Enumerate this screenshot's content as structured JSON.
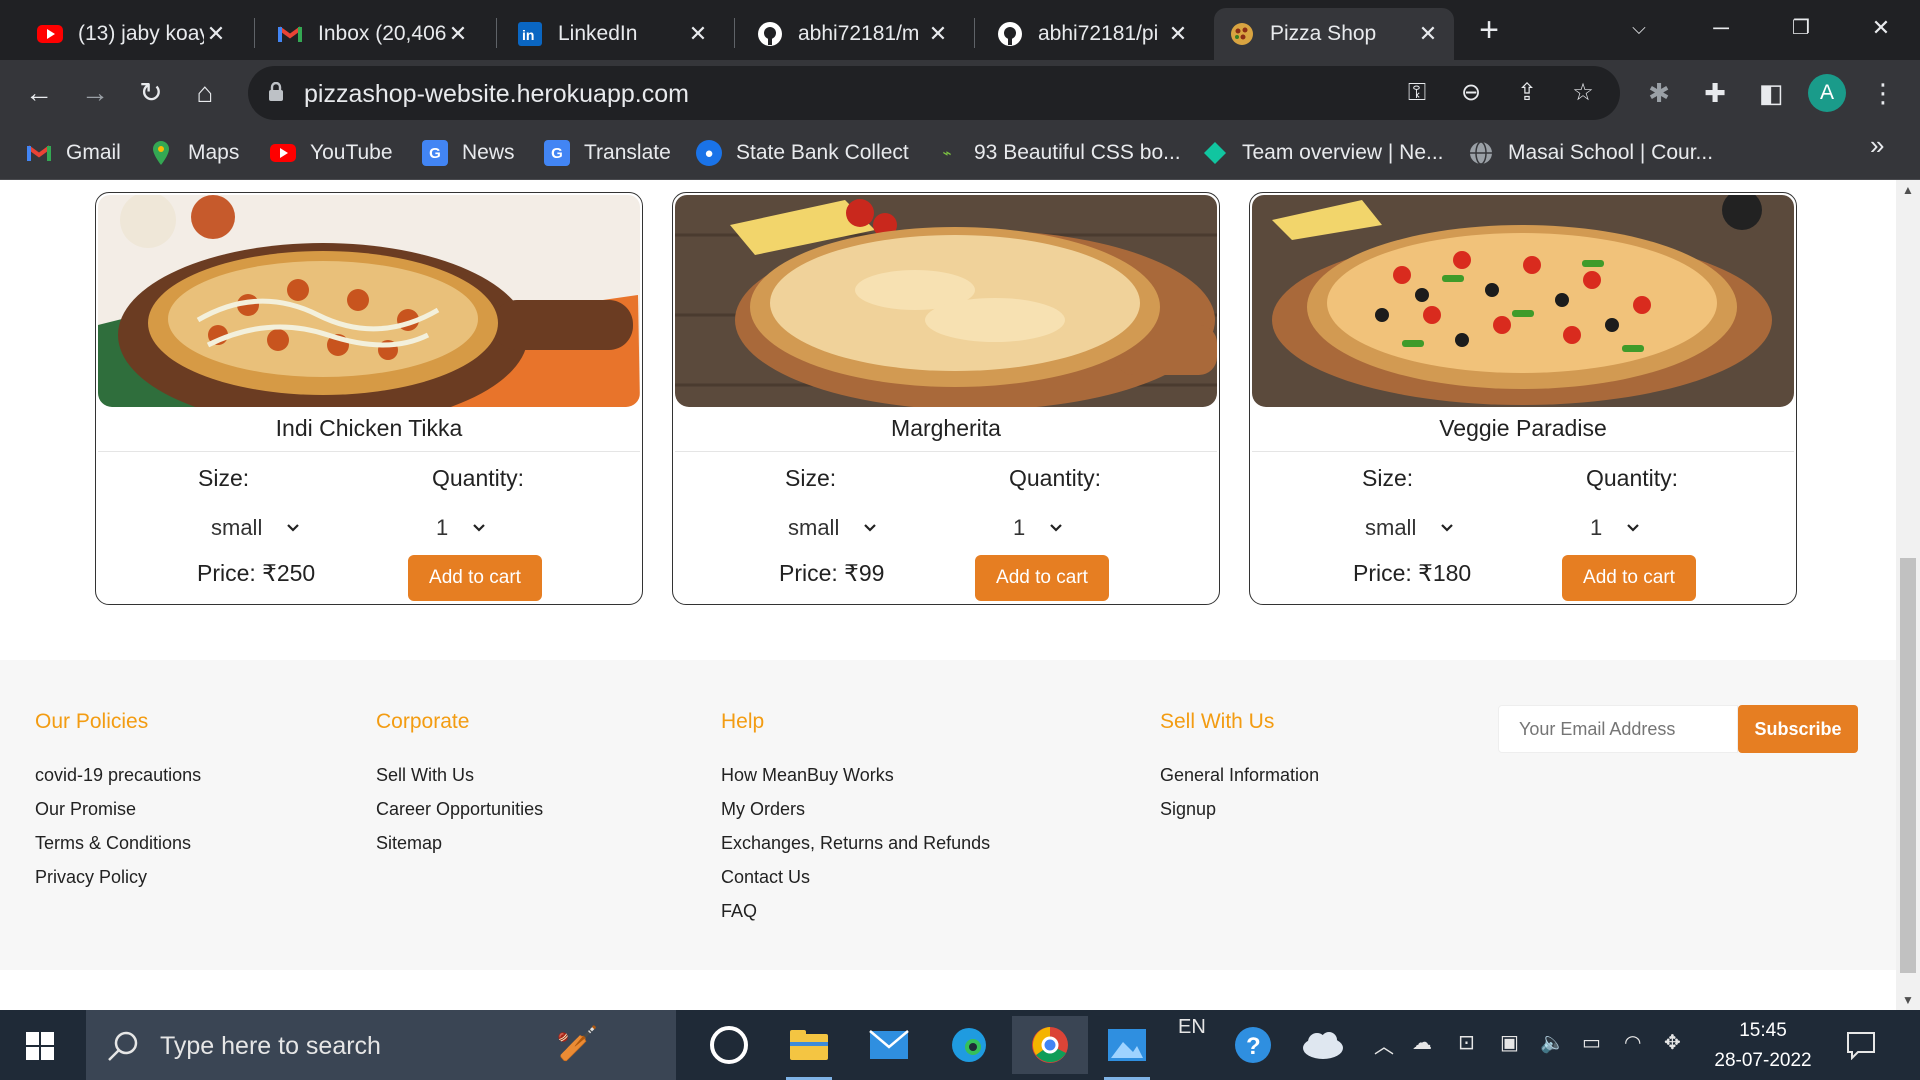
{
  "browser": {
    "tabs": [
      {
        "title": "(13) jaby koay",
        "icon": "youtube-icon"
      },
      {
        "title": "Inbox (20,406",
        "icon": "gmail-icon"
      },
      {
        "title": "LinkedIn",
        "icon": "linkedin-icon"
      },
      {
        "title": "abhi72181/m",
        "icon": "github-icon"
      },
      {
        "title": "abhi72181/pi",
        "icon": "github-icon"
      },
      {
        "title": "Pizza Shop",
        "icon": "pizza-icon",
        "active": true
      }
    ],
    "url": "pizzashop-website.herokuapp.com",
    "profile_initial": "A",
    "bookmarks": [
      {
        "label": "Gmail",
        "icon": "gmail-icon"
      },
      {
        "label": "Maps",
        "icon": "maps-icon"
      },
      {
        "label": "YouTube",
        "icon": "youtube-icon"
      },
      {
        "label": "News",
        "icon": "news-icon"
      },
      {
        "label": "Translate",
        "icon": "translate-icon"
      },
      {
        "label": "State Bank Collect",
        "icon": "sbi-icon"
      },
      {
        "label": "93 Beautiful CSS bo...",
        "icon": "css-icon"
      },
      {
        "label": "Team overview | Ne...",
        "icon": "diamond-icon"
      },
      {
        "label": "Masai School | Cour...",
        "icon": "globe-icon"
      }
    ]
  },
  "products": [
    {
      "name": "Indi Chicken Tikka",
      "size_label": "Size:",
      "size": "small",
      "qty_label": "Quantity:",
      "qty": "1",
      "price": "Price: ₹250",
      "button": "Add to cart"
    },
    {
      "name": "Margherita",
      "size_label": "Size:",
      "size": "small",
      "qty_label": "Quantity:",
      "qty": "1",
      "price": "Price: ₹99",
      "button": "Add to cart"
    },
    {
      "name": "Veggie Paradise",
      "size_label": "Size:",
      "size": "small",
      "qty_label": "Quantity:",
      "qty": "1",
      "price": "Price: ₹180",
      "button": "Add to cart"
    }
  ],
  "footer": {
    "columns": [
      {
        "heading": "Our Policies",
        "links": [
          "covid-19 precautions",
          "Our Promise",
          "Terms & Conditions",
          "Privacy Policy"
        ]
      },
      {
        "heading": "Corporate",
        "links": [
          "Sell With Us",
          "Career Opportunities",
          "Sitemap"
        ]
      },
      {
        "heading": "Help",
        "links": [
          "How MeanBuy Works",
          "My Orders",
          "Exchanges, Returns and Refunds",
          "Contact Us",
          "FAQ"
        ]
      },
      {
        "heading": "Sell With Us",
        "links": [
          "General Information",
          "Signup"
        ]
      }
    ],
    "email_placeholder": "Your Email Address",
    "subscribe_label": "Subscribe"
  },
  "taskbar": {
    "search_placeholder": "Type here to search",
    "language": "EN",
    "time": "15:45",
    "date": "28-07-2022"
  },
  "colors": {
    "accent": "#e67e22",
    "footer_heading": "#f39c12",
    "browser_dark": "#202124",
    "browser_toolbar": "#35363a"
  }
}
